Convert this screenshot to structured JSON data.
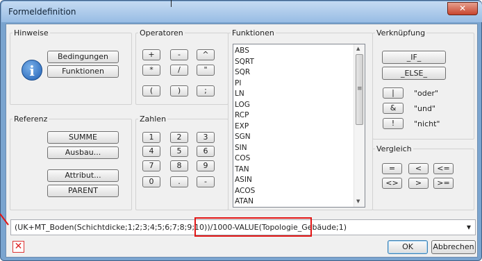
{
  "window": {
    "title": "Formeldefinition",
    "close_glyph": "✕"
  },
  "hinweise": {
    "label": "Hinweise",
    "buttons": [
      "Bedingungen",
      "Funktionen"
    ],
    "icon": "info-icon",
    "icon_glyph": "i"
  },
  "operatoren": {
    "label": "Operatoren",
    "rows": [
      [
        "+",
        "-",
        "^"
      ],
      [
        "*",
        "/",
        "\""
      ],
      [
        "(",
        ")",
        ";"
      ]
    ]
  },
  "zahlen": {
    "label": "Zahlen",
    "rows": [
      [
        "1",
        "2",
        "3"
      ],
      [
        "4",
        "5",
        "6"
      ],
      [
        "7",
        "8",
        "9"
      ],
      [
        "0",
        ".",
        "-"
      ]
    ]
  },
  "referenz": {
    "label": "Referenz",
    "buttons": [
      "SUMME",
      "Ausbau...",
      "Attribut...",
      "PARENT"
    ]
  },
  "funktionen": {
    "label": "Funktionen",
    "items": [
      "ABS",
      "SQRT",
      "SQR",
      "PI",
      "LN",
      "LOG",
      "RCP",
      "EXP",
      "SGN",
      "SIN",
      "COS",
      "TAN",
      "ASIN",
      "ACOS",
      "ATAN"
    ],
    "scroll_mid_glyph": "≡"
  },
  "verknuepfung": {
    "label": "Verknüpfung",
    "buttons": [
      "_IF_",
      "_ELSE_"
    ],
    "ops": [
      {
        "sym": "|",
        "text": "\"oder\""
      },
      {
        "sym": "&",
        "text": "\"und\""
      },
      {
        "sym": "!",
        "text": "\"nicht\""
      }
    ]
  },
  "vergleich": {
    "label": "Vergleich",
    "rows": [
      [
        "=",
        "<",
        "<="
      ],
      [
        "<>",
        ">",
        ">="
      ]
    ]
  },
  "formula": {
    "value": "(UK+MT_Boden(Schichtdicke;1;2;3;4;5;6;7;8;9;10))/1000-VALUE(Topologie_Gebäude;1)",
    "dropdown_glyph": "▾"
  },
  "footer": {
    "error_glyph": "✕",
    "ok": "OK",
    "cancel": "Abbrechen"
  },
  "colors": {
    "highlight": "#e11414",
    "info": "#1f5fb4"
  }
}
